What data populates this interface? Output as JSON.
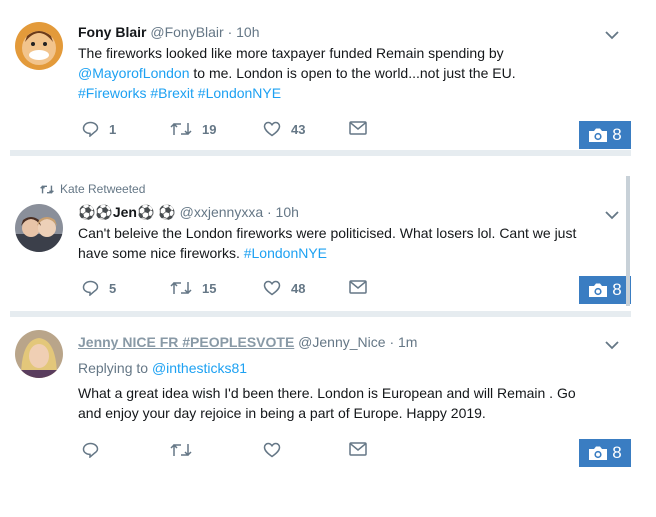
{
  "tweets": [
    {
      "name": "Fony Blair",
      "handle": "@FonyBlair",
      "time": "· 10h",
      "line1": "The fireworks looked like more taxpayer funded Remain spending by",
      "mention": "@MayorofLondon",
      "line2_rest": " to me. London is open to the world...not just the EU.",
      "hashtags": "#Fireworks #Brexit #LondonNYE",
      "reply_count": "1",
      "retweet_count": "19",
      "like_count": "43",
      "photo_count": "8"
    },
    {
      "retweeted_by": "Kate Retweeted",
      "name": "⚽⚽Jen⚽ ⚽",
      "handle": "@xxjennyxxa",
      "time": "· 10h",
      "line1": "Can't beleive the London fireworks were politicised. What losers lol. Cant we just",
      "line2": "have some nice fireworks. ",
      "hashtag": "#LondonNYE",
      "reply_count": "5",
      "retweet_count": "15",
      "like_count": "48",
      "photo_count": "8"
    },
    {
      "name": "Jenny NICE FR #PEOPLESVOTE",
      "handle": "@Jenny_Nice",
      "time": "· 1m",
      "replying_label": "Replying to ",
      "replying_to": "@inthesticks81",
      "line1": "What a great idea wish I'd been there. London is European and  will Remain . Go",
      "line2": "and enjoy your day rejoice in being a part of  Europe. Happy 2019.",
      "photo_count": "8"
    }
  ],
  "colors": {
    "link": "#1da1f2",
    "muted": "#657786",
    "camera_badge": "#3a7dc2",
    "separator": "#e6ecf0"
  }
}
